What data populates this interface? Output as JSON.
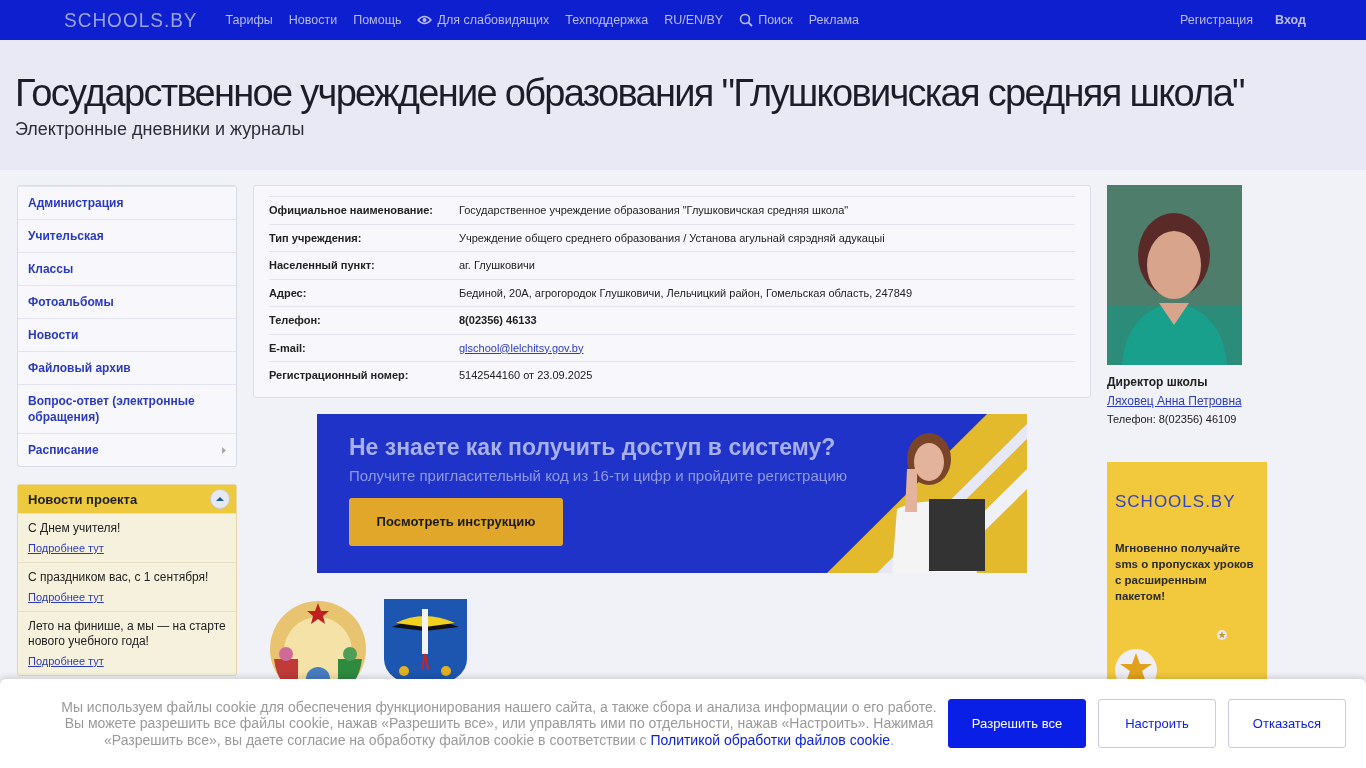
{
  "nav": {
    "logo": "SCHOOLS.BY",
    "links": [
      {
        "label": "Тарифы",
        "kind": "plain"
      },
      {
        "label": "Новости",
        "kind": "plain"
      },
      {
        "label": "Помощь",
        "kind": "plain"
      },
      {
        "label": "Для слабовидящих",
        "kind": "accessibility"
      },
      {
        "label": "Техподдержка",
        "kind": "plain"
      },
      {
        "label": "RU/EN/BY",
        "kind": "plain"
      },
      {
        "label": "Поиск",
        "kind": "search"
      },
      {
        "label": "Реклама",
        "kind": "plain"
      }
    ],
    "register": "Регистрация",
    "login": "Вход"
  },
  "header": {
    "title": "Государственное учреждение образования \"Глушковичская средняя школа\"",
    "subtitle": "Электронные дневники и журналы"
  },
  "sidebar": {
    "items": [
      {
        "label": "Администрация",
        "has_submenu": false
      },
      {
        "label": "Учительская",
        "has_submenu": false
      },
      {
        "label": "Классы",
        "has_submenu": false
      },
      {
        "label": "Фотоальбомы",
        "has_submenu": false
      },
      {
        "label": "Новости",
        "has_submenu": false
      },
      {
        "label": "Файловый архив",
        "has_submenu": false
      },
      {
        "label": "Вопрос-ответ (электронные обращения)",
        "has_submenu": false
      },
      {
        "label": "Расписание",
        "has_submenu": true
      }
    ]
  },
  "project_news": {
    "title": "Новости проекта",
    "expanded": true,
    "items": [
      {
        "text": "С Днем учителя!",
        "link": "Подробнее тут"
      },
      {
        "text": "С праздником вас, с 1 сентября!",
        "link": "Подробнее тут"
      },
      {
        "text": "Лето на финише, а мы — на старте нового учебного года!",
        "link": "Подробнее тут"
      }
    ]
  },
  "info": {
    "rows": [
      {
        "label": "Официальное наименование:",
        "value": "Государственное учреждение образования \"Глушковичская средняя школа\"",
        "kind": "text"
      },
      {
        "label": "Тип учреждения:",
        "value": "Учреждение общего среднего образования / Установа агульнай сярэдняй адукацыі",
        "kind": "text"
      },
      {
        "label": "Населенный пункт:",
        "value": "аг. Глушковичи",
        "kind": "text"
      },
      {
        "label": "Адрес:",
        "value": "Бединой, 20А, агрогородок Глушковичи, Лельчицкий район, Гомельская область, 247849",
        "kind": "text"
      },
      {
        "label": "Телефон:",
        "value": "8(02356) 46133",
        "kind": "bold"
      },
      {
        "label": "E-mail:",
        "value": "glschool@lelchitsy.gov.by",
        "kind": "link"
      },
      {
        "label": "Регистрационный номер:",
        "value": "5142544160 от 23.09.2025",
        "kind": "text"
      }
    ]
  },
  "banner": {
    "title": "Не знаете как получить доступ в систему?",
    "text": "Получите пригласительный код из 16-ти цифр и пройдите регистрацию",
    "button": "Посмотреть инструкцию"
  },
  "director": {
    "role": "Директор школы",
    "name": "Ляховец Анна Петровна",
    "phone": "Телефон: 8(02356) 46109"
  },
  "ad": {
    "logo": "SCHOOLS.BY",
    "text": "Мгновенно получайте sms о пропусках уроков с расширенным пакетом!"
  },
  "cookie": {
    "text": "Мы используем файлы cookie для обеспечения функционирования нашего сайта, а также сбора и анализа информации о его работе. Вы можете разрешить все файлы cookie, нажав «Разрешить все», или управлять ими по отдельности, нажав «Настроить». Нажимая «Разрешить все», вы даете согласие на обработку файлов cookie в соответствии с",
    "link": "Политикой обработки файлов cookie",
    "end": ".",
    "buttons": [
      {
        "label": "Разрешить все",
        "primary": true
      },
      {
        "label": "Настроить",
        "primary": false
      },
      {
        "label": "Отказаться",
        "primary": false
      }
    ]
  }
}
